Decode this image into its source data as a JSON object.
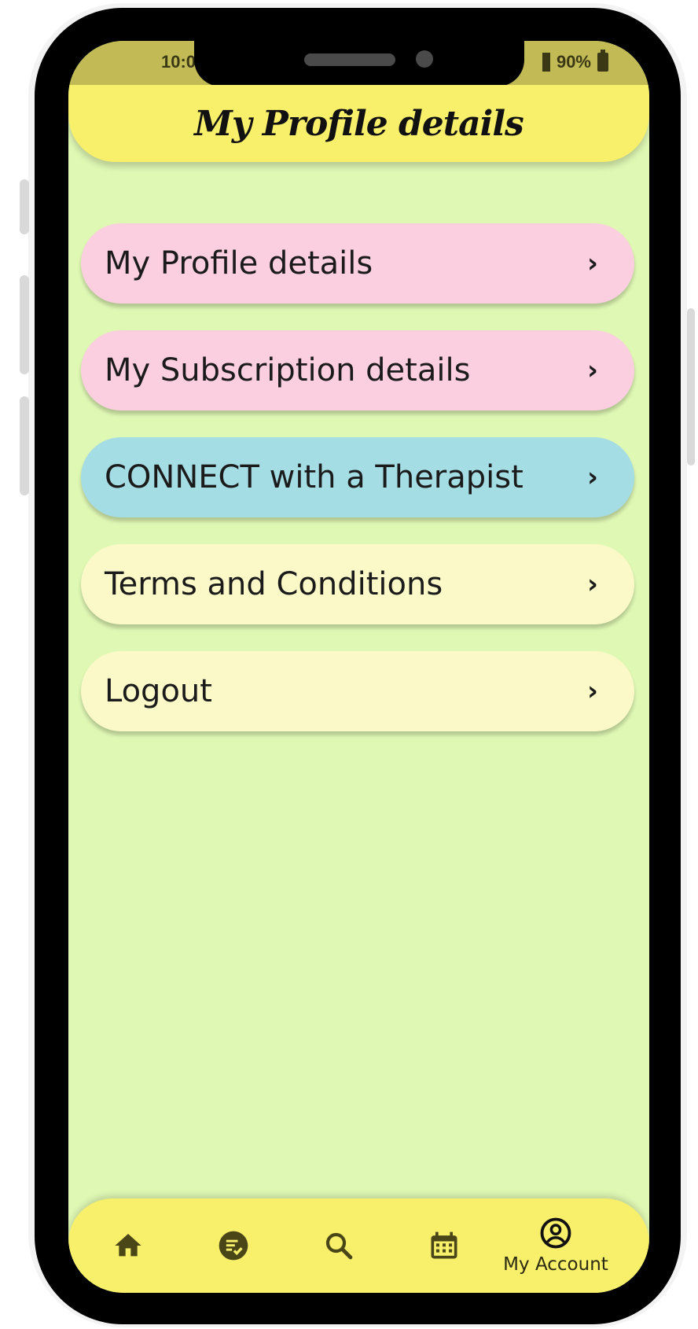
{
  "status_bar": {
    "time": "10:0",
    "battery": "90%"
  },
  "header": {
    "title": "My Profile details"
  },
  "menu": {
    "items": [
      {
        "label": "My Profile details",
        "color": "#fbcfdf"
      },
      {
        "label": "My Subscription details",
        "color": "#fbcfdf"
      },
      {
        "label": "CONNECT with a Therapist",
        "color": "#a5dde5"
      },
      {
        "label": "Terms and Conditions",
        "color": "#fcf9c8"
      },
      {
        "label": "Logout",
        "color": "#fcf9c8"
      }
    ],
    "chevron": "›"
  },
  "bottom_nav": {
    "items": [
      {
        "icon": "home-icon"
      },
      {
        "icon": "notes-check-icon"
      },
      {
        "icon": "search-icon"
      },
      {
        "icon": "calendar-icon"
      },
      {
        "icon": "account-circle-icon",
        "label": "My Account"
      }
    ]
  },
  "colors": {
    "background": "#dff8b4",
    "header": "#f8f06a",
    "status_bar": "#c2bb55"
  }
}
